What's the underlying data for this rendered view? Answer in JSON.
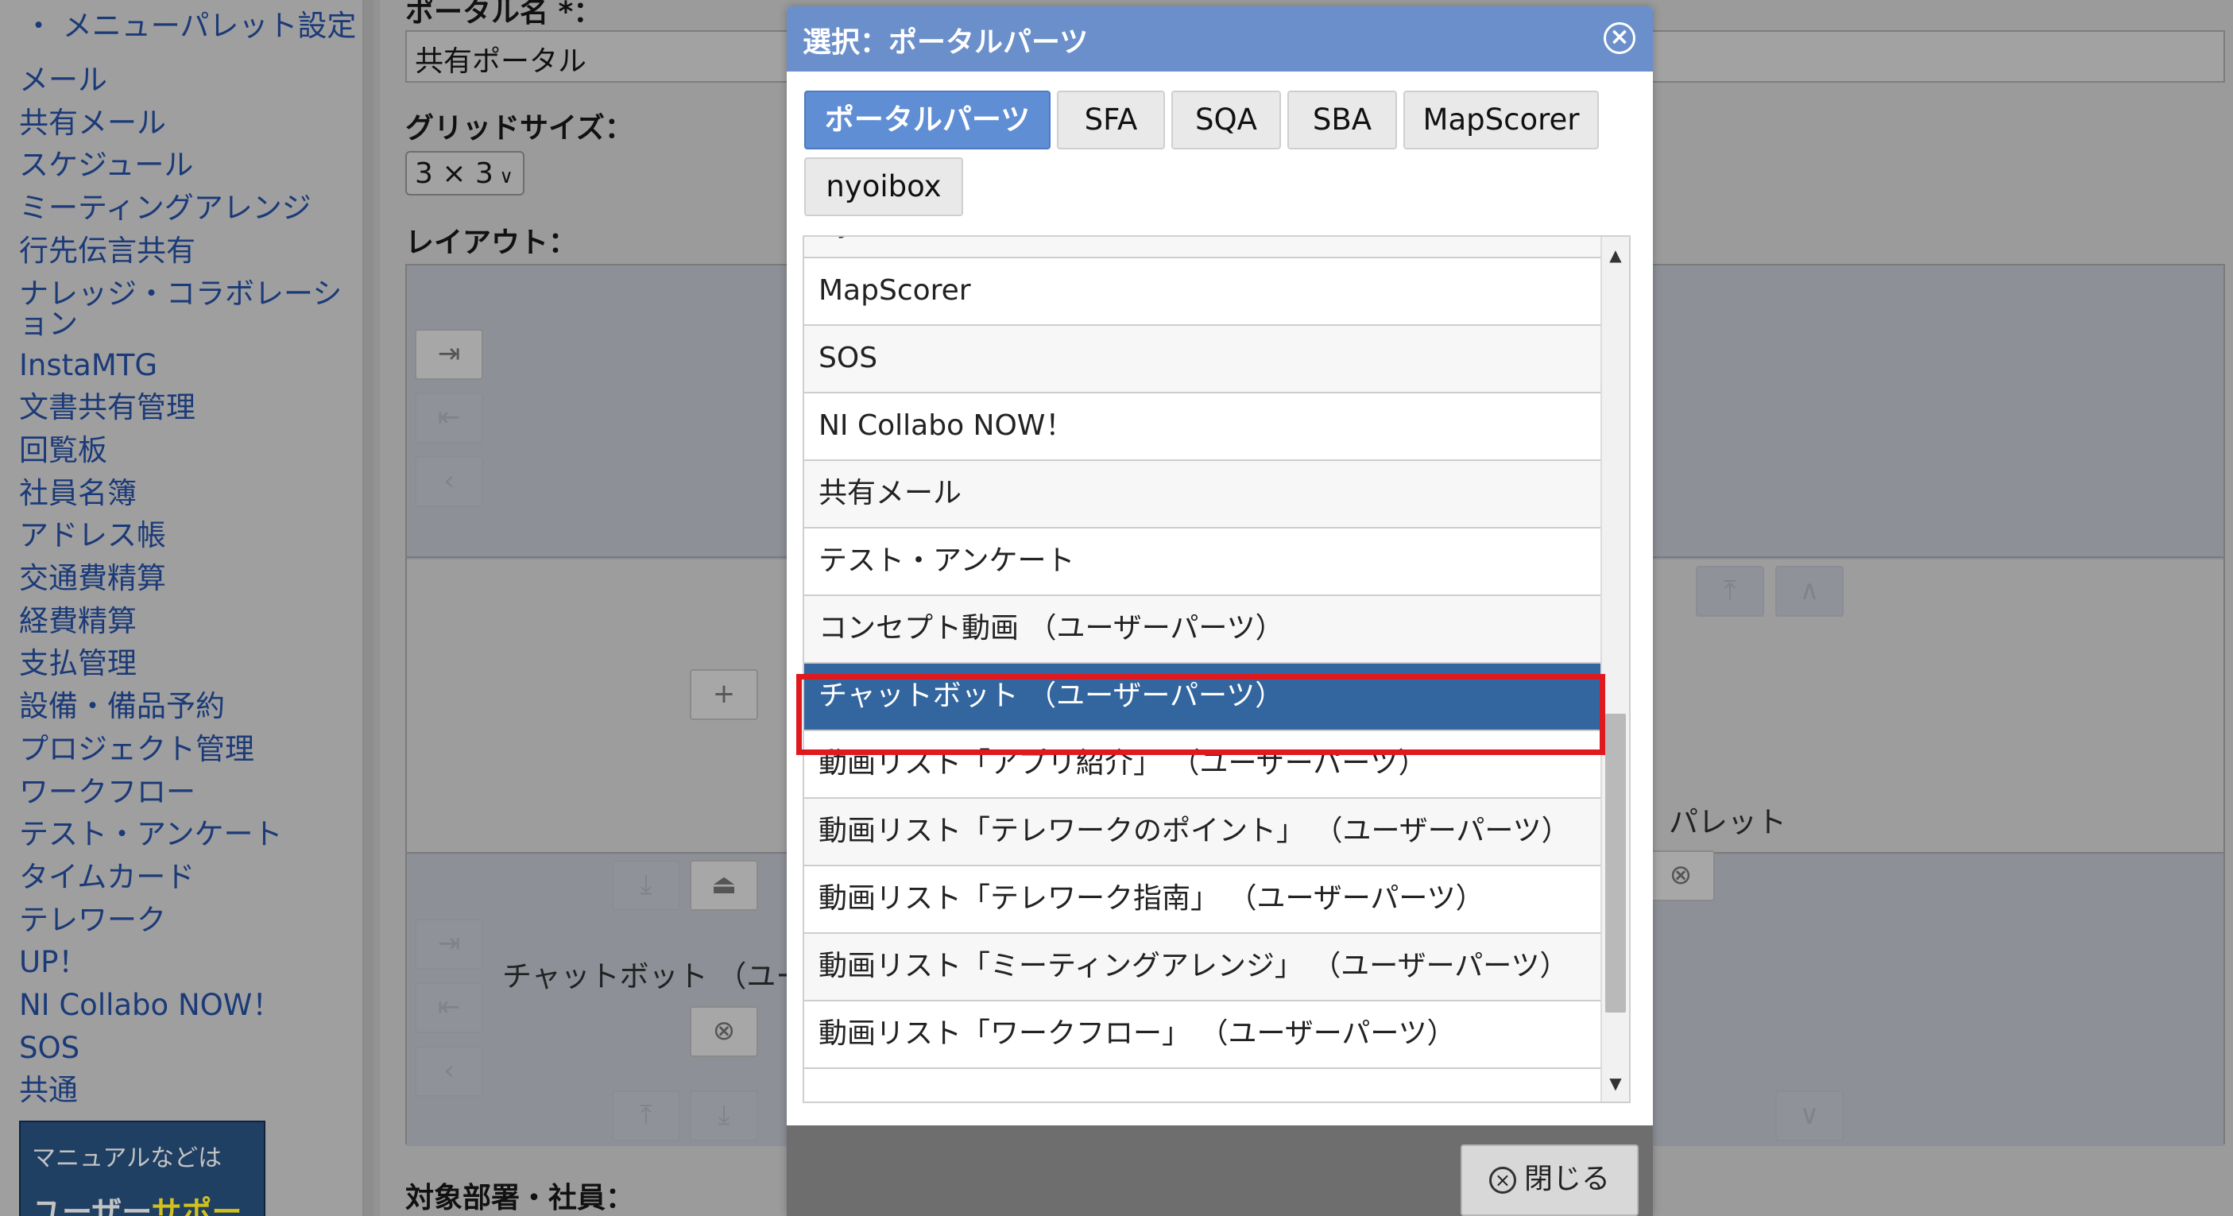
{
  "sidebar": {
    "menu_setting": "・ メニューパレット設定",
    "items": [
      "メール",
      "共有メール",
      "スケジュール",
      "ミーティングアレンジ",
      "行先伝言共有",
      "ナレッジ・コラボレーション",
      "InstaMTG",
      "文書共有管理",
      "回覧板",
      "社員名簿",
      "アドレス帳",
      "交通費精算",
      "経費精算",
      "支払管理",
      "設備・備品予約",
      "プロジェクト管理",
      "ワークフロー",
      "テスト・アンケート",
      "タイムカード",
      "テレワーク",
      "UP！",
      "NI Collabo NOW！",
      "SOS",
      "共通"
    ],
    "banner_line1": "マニュアルなどは",
    "banner_line2_a": "ユーザー",
    "banner_line2_b": "サポート"
  },
  "form": {
    "portal_name_label": "ポータル名 *：",
    "portal_name_value": "共有ポータル",
    "grid_size_label": "グリッドサイズ：",
    "grid_size_value": "3 × 3",
    "layout_label": "レイアウト：",
    "target_label": "対象部署・社員：",
    "placed_part_label": "チャットボット （ユーザ",
    "right_label": "パレット"
  },
  "dialog": {
    "title": "選択：ポータルパーツ",
    "tabs": [
      "ポータルパーツ",
      "SFA",
      "SQA",
      "SBA",
      "MapScorer",
      "nyoibox"
    ],
    "active_tab": "ポータルパーツ",
    "list_items": [
      "nyoibox",
      "MapScorer",
      "SOS",
      "NI Collabo NOW！",
      "共有メール",
      "テスト・アンケート",
      "コンセプト動画 （ユーザーパーツ）",
      "チャットボット （ユーザーパーツ）",
      "動画リスト「アプリ紹介」 （ユーザーパーツ）",
      "動画リスト「テレワークのポイント」 （ユーザーパーツ）",
      "動画リスト「テレワーク指南」 （ユーザーパーツ）",
      "動画リスト「ミーティングアレンジ」 （ユーザーパーツ）",
      "動画リスト「ワークフロー」 （ユーザーパーツ）"
    ],
    "selected_item": "チャットボット （ユーザーパーツ）",
    "close_button": "閉じる"
  },
  "colors": {
    "dialog_header": "#6a8fcb",
    "active_tab": "#5f8ed4",
    "selected_row": "#33669e",
    "highlight": "#e0191f"
  }
}
